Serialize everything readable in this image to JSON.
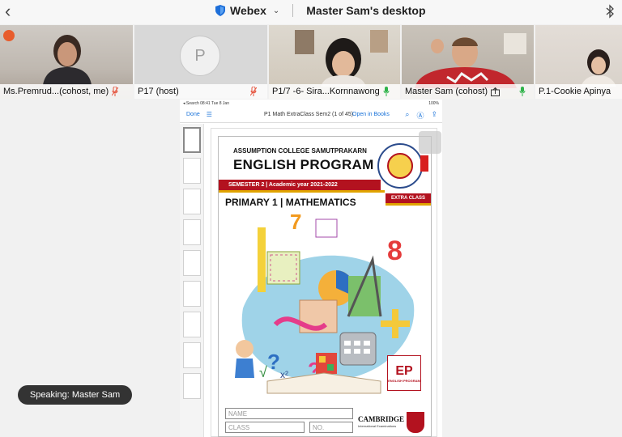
{
  "topbar": {
    "back_icon": "chevron-left-icon",
    "app_name": "Webex",
    "desktop_title": "Master Sam's desktop"
  },
  "participants": [
    {
      "name": "Ms.Premrud...(cohost, me)",
      "mic": "muted"
    },
    {
      "name": "P17 (host)",
      "mic": "muted",
      "avatar_letter": "P"
    },
    {
      "name": "P1/7 -6- Sira...Kornnawong",
      "mic": "active"
    },
    {
      "name": "Master Sam (cohost)",
      "mic": "active",
      "sharing": true
    },
    {
      "name": "P.1-Cookie Apinya"
    }
  ],
  "shared_screen": {
    "status_left": "◂ Search  08:41  Tue 8 Jan",
    "status_right": "100%",
    "done_label": "Done",
    "doc_title": "P1 Math ExtraClass Sem2 (1 of 45)",
    "open_in_books": "Open in Books",
    "cover": {
      "school": "ASSUMPTION COLLEGE SAMUTPRAKARN",
      "program": "ENGLISH PROGRAM",
      "semester": "SEMESTER 2  |  Academic year 2021-2022",
      "subject": "PRIMARY 1 | MATHEMATICS",
      "extra_class": "EXTRA CLASS",
      "ep_logo_letters": "EP",
      "ep_logo_sub": "ENGLISH PROGRAM",
      "name_field": "NAME",
      "class_field": "CLASS",
      "no_field": "NO.",
      "cambridge": "CAMBRIDGE",
      "cambridge_sub": "International Examinations"
    }
  },
  "toast": {
    "speaking": "Speaking: Master Sam"
  },
  "colors": {
    "accent_red": "#b3121f",
    "accent_gold": "#e0a400",
    "link_blue": "#1a73d9",
    "webex_blue": "#1e6fd9",
    "mic_muted": "#e5533d",
    "mic_active": "#2fb34a"
  }
}
